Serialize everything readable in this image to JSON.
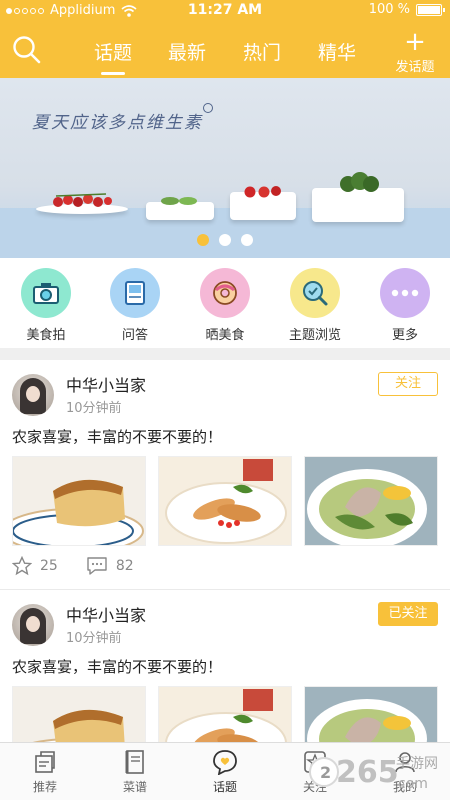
{
  "status_bar": {
    "carrier": "Applidium",
    "time": "11:27 AM",
    "battery": "100 %"
  },
  "header": {
    "tabs": [
      {
        "label": "话题",
        "active": true
      },
      {
        "label": "最新",
        "active": false
      },
      {
        "label": "热门",
        "active": false
      },
      {
        "label": "精华",
        "active": false
      }
    ],
    "post_button_label": "发话题",
    "accent_color": "#f8c13a"
  },
  "banner": {
    "text": "夏天应该多点维生素",
    "slide_count": 3,
    "active_slide": 1
  },
  "quick_links": [
    {
      "label": "美食拍",
      "icon": "camera-icon",
      "color": "#8ee8d0"
    },
    {
      "label": "问答",
      "icon": "book-icon",
      "color": "#a9d4f5"
    },
    {
      "label": "晒美食",
      "icon": "donut-icon",
      "color": "#f5b8d6"
    },
    {
      "label": "主题浏览",
      "icon": "magnifier-check-icon",
      "color": "#f7e88c"
    },
    {
      "label": "更多",
      "icon": "more-dots-icon",
      "color": "#cfb3f2"
    }
  ],
  "posts": [
    {
      "username": "中华小当家",
      "time": "10分钟前",
      "follow_label": "关注",
      "text": "农家喜宴，丰富的不要不要的！",
      "likes": "25",
      "comments": "82"
    },
    {
      "username": "中华小当家",
      "time": "10分钟前",
      "follow_label": "已关注",
      "text": "农家喜宴，丰富的不要不要的！"
    }
  ],
  "bottom_nav": [
    {
      "label": "推荐",
      "icon": "recommend-icon"
    },
    {
      "label": "菜谱",
      "icon": "recipe-icon"
    },
    {
      "label": "话题",
      "icon": "topic-heart-icon",
      "active": true
    },
    {
      "label": "关注",
      "icon": "follow-star-icon"
    },
    {
      "label": "我的",
      "icon": "profile-icon"
    }
  ],
  "watermark": {
    "brand": "265",
    "site": "手游网",
    "domain": "com"
  }
}
